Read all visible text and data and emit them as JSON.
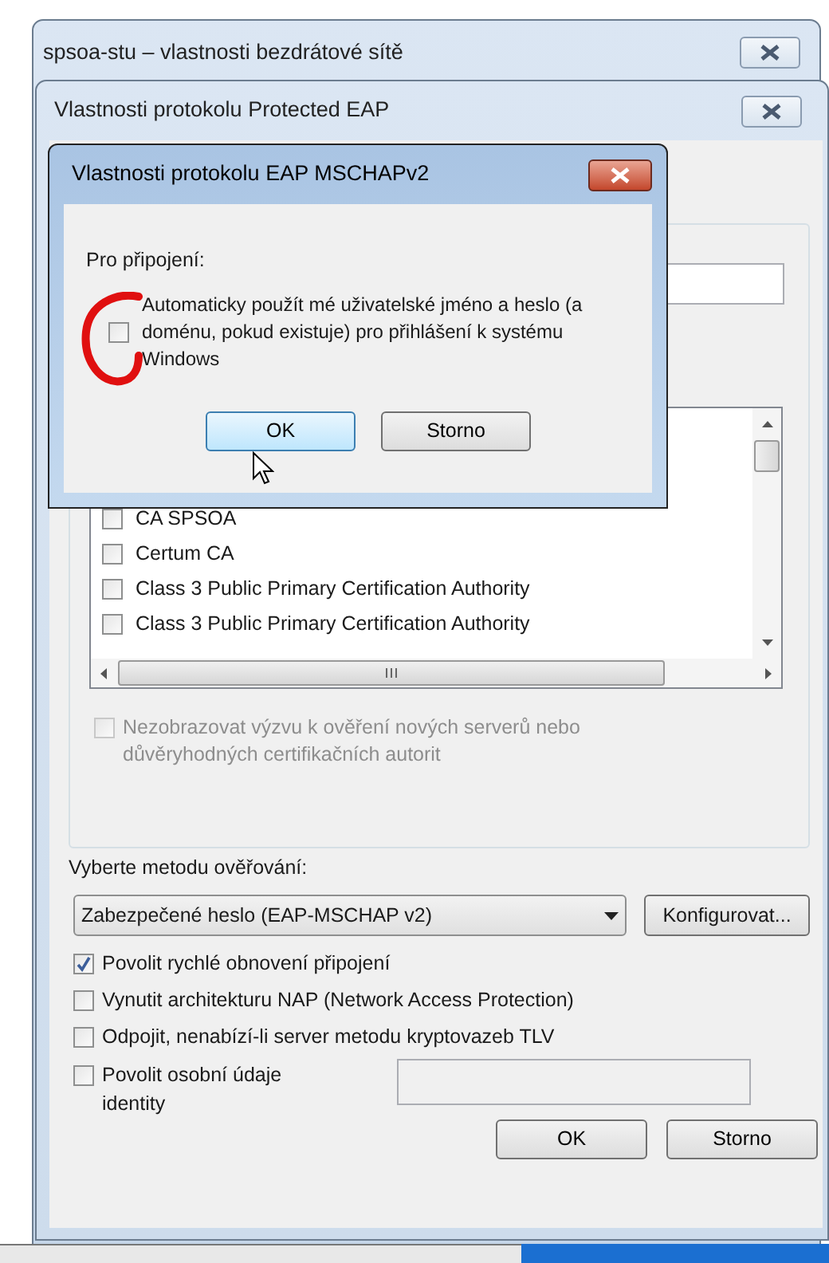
{
  "outer_window": {
    "title": "spsoa-stu – vlastnosti bezdrátové sítě"
  },
  "peap_window": {
    "title": "Vlastnosti protokolu Protected EAP",
    "certificates": [
      {
        "label": "CA SPSOA",
        "checked": false
      },
      {
        "label": "Certum CA",
        "checked": false
      },
      {
        "label": "Class 3 Public Primary Certification Authority",
        "checked": false
      },
      {
        "label": "Class 3 Public Primary Certification Authority",
        "checked": false
      }
    ],
    "no_prompt_option": {
      "label": "Nezobrazovat výzvu k ověření nových serverů nebo důvěryhodných certifikačních autorit",
      "checked": false,
      "disabled": true
    },
    "method_label": "Vyberte metodu ověřování:",
    "method_select": {
      "value": "Zabezpečené heslo (EAP-MSCHAP v2)"
    },
    "configure_button": "Konfigurovat...",
    "options": [
      {
        "label": "Povolit rychlé obnovení připojení",
        "checked": true
      },
      {
        "label": "Vynutit architekturu NAP (Network Access Protection)",
        "checked": false
      },
      {
        "label": "Odpojit, nenabízí-li server metodu kryptovazeb TLV",
        "checked": false
      },
      {
        "label": "Povolit osobní údaje identity",
        "checked": false
      }
    ],
    "buttons": [
      {
        "label": "OK"
      },
      {
        "label": "Storno"
      }
    ]
  },
  "mschap_dialog": {
    "title": "Vlastnosti protokolu EAP MSCHAPv2",
    "group_label": "Pro připojení:",
    "option": {
      "label": "Automaticky použít mé uživatelské jméno a heslo (a doménu, pokud existuje) pro přihlášení k systému Windows",
      "checked": false
    },
    "buttons": [
      {
        "label": "OK",
        "highlighted": true
      },
      {
        "label": "Storno",
        "highlighted": false
      }
    ]
  }
}
